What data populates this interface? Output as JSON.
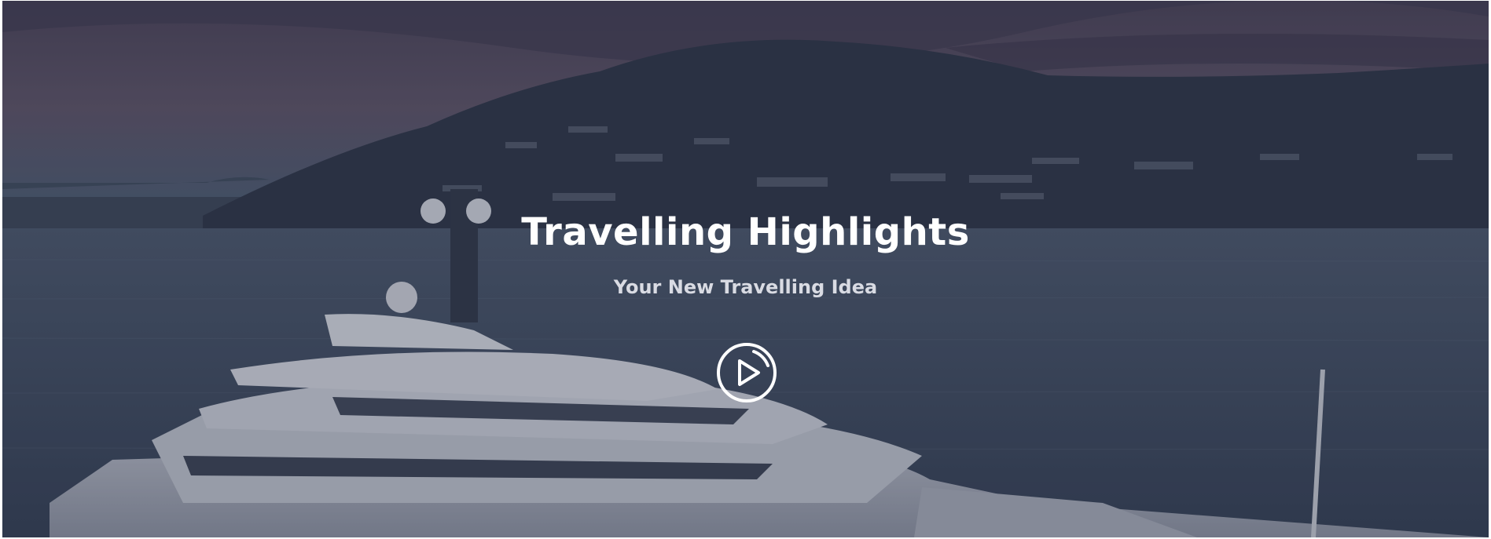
{
  "hero": {
    "title": "Travelling Highlights",
    "subtitle": "Your New Travelling Idea",
    "play_icon": "play-circle-icon",
    "background_image": "yacht-at-dusk-near-hillside-coastline"
  },
  "colors": {
    "sky_top": "#4a4356",
    "sky_mid": "#5b5366",
    "sea": "#3e4a5e",
    "hill": "#2e3546",
    "text": "#ffffff",
    "subtitle_text": "#d9dbe3"
  }
}
